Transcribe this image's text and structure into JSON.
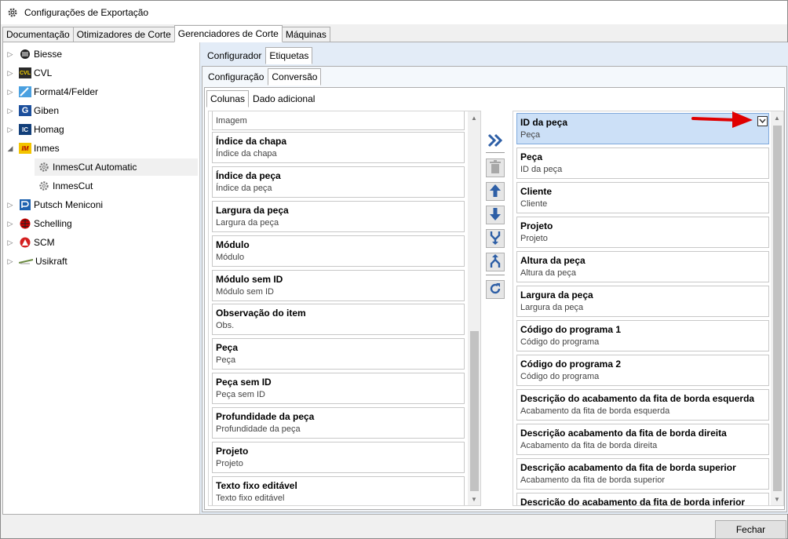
{
  "window": {
    "title": "Configurações de Exportação"
  },
  "main_tabs": [
    {
      "label": "Documentação",
      "active": false
    },
    {
      "label": "Otimizadores de Corte",
      "active": false
    },
    {
      "label": "Gerenciadores de Corte",
      "active": true
    },
    {
      "label": "Máquinas",
      "active": false
    }
  ],
  "tree": [
    {
      "label": "Biesse",
      "icon": "biesse-logo-icon",
      "expanded": false
    },
    {
      "label": "CVL",
      "icon": "cvl-logo-icon",
      "expanded": false
    },
    {
      "label": "Format4/Felder",
      "icon": "format4-logo-icon",
      "expanded": false
    },
    {
      "label": "Giben",
      "icon": "giben-logo-icon",
      "expanded": false
    },
    {
      "label": "Homag",
      "icon": "homag-logo-icon",
      "expanded": false
    },
    {
      "label": "Inmes",
      "icon": "inmes-logo-icon",
      "expanded": true
    },
    {
      "label": "InmesCut Automatic",
      "icon": "gear-icon",
      "child": true,
      "selected": true
    },
    {
      "label": "InmesCut",
      "icon": "gear-icon",
      "child": true
    },
    {
      "label": "Putsch Meniconi",
      "icon": "putsch-logo-icon",
      "expanded": false
    },
    {
      "label": "Schelling",
      "icon": "schelling-logo-icon",
      "expanded": false
    },
    {
      "label": "SCM",
      "icon": "scm-logo-icon",
      "expanded": false
    },
    {
      "label": "Usikraft",
      "icon": "usikraft-logo-icon",
      "expanded": false
    }
  ],
  "subtabs_level1": [
    {
      "label": "Configurador",
      "active": false
    },
    {
      "label": "Etiquetas",
      "active": true
    }
  ],
  "subtabs_level2": [
    {
      "label": "Configuração",
      "active": false
    },
    {
      "label": "Conversão",
      "active": true
    }
  ],
  "subtabs_level3": [
    {
      "label": "Colunas",
      "active": true
    },
    {
      "label": "Dado adicional",
      "active": false
    }
  ],
  "available_columns": [
    {
      "title": "",
      "subtitle": "Imagem"
    },
    {
      "title": "Índice da chapa",
      "subtitle": "Índice da chapa"
    },
    {
      "title": "Índice da peça",
      "subtitle": "Índice da peça"
    },
    {
      "title": "Largura da peça",
      "subtitle": "Largura da peça"
    },
    {
      "title": "Módulo",
      "subtitle": "Módulo"
    },
    {
      "title": "Módulo sem ID",
      "subtitle": "Módulo sem ID"
    },
    {
      "title": "Observação do item",
      "subtitle": "Obs."
    },
    {
      "title": "Peça",
      "subtitle": "Peça"
    },
    {
      "title": "Peça sem ID",
      "subtitle": "Peça sem ID"
    },
    {
      "title": "Profundidade da peça",
      "subtitle": "Profundidade da peça"
    },
    {
      "title": "Projeto",
      "subtitle": "Projeto"
    },
    {
      "title": "Texto fixo editável",
      "subtitle": "Texto fixo editável"
    }
  ],
  "selected_columns": [
    {
      "title": "ID da peça",
      "subtitle": "Peça",
      "selected": true
    },
    {
      "title": "Peça",
      "subtitle": "ID da peça"
    },
    {
      "title": "Cliente",
      "subtitle": "Cliente"
    },
    {
      "title": "Projeto",
      "subtitle": "Projeto"
    },
    {
      "title": "Altura da peça",
      "subtitle": "Altura da peça"
    },
    {
      "title": "Largura da peça",
      "subtitle": "Largura da peça"
    },
    {
      "title": "Código do programa 1",
      "subtitle": "Código do programa"
    },
    {
      "title": "Código do programa 2",
      "subtitle": "Código do programa"
    },
    {
      "title": "Descrição do acabamento da fita de borda esquerda",
      "subtitle": "Acabamento da fita de borda esquerda"
    },
    {
      "title": "Descrição acabamento da fita de borda direita",
      "subtitle": "Acabamento da fita de borda direita"
    },
    {
      "title": "Descrição acabamento da fita de borda superior",
      "subtitle": "Acabamento da fita de borda superior"
    },
    {
      "title": "Descrição do acabamento da fita de borda inferior",
      "subtitle": ""
    }
  ],
  "colors": {
    "selection": "#cce0f7",
    "accent_icon": "#2e5fa6",
    "annotation_arrow": "#e00000"
  },
  "footer": {
    "close_label": "Fechar"
  }
}
